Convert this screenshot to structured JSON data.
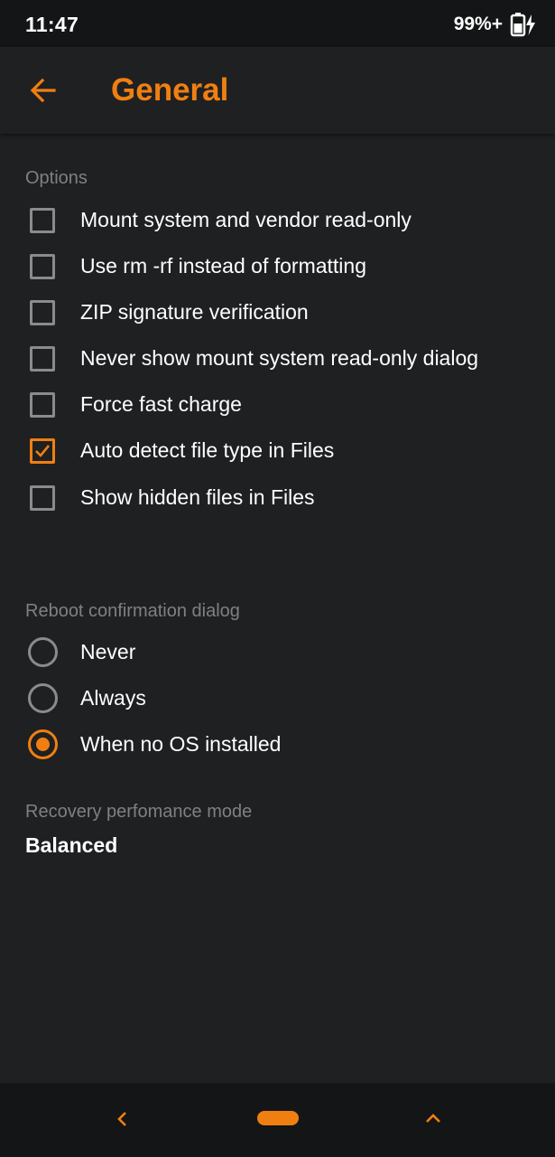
{
  "status": {
    "time": "11:47",
    "battery": "99%+"
  },
  "header": {
    "title": "General"
  },
  "options": {
    "header": "Options",
    "items": [
      {
        "label": "Mount system and vendor read-only",
        "checked": false
      },
      {
        "label": "Use rm -rf instead of formatting",
        "checked": false
      },
      {
        "label": "ZIP signature verification",
        "checked": false
      },
      {
        "label": "Never show mount system read-only dialog",
        "checked": false
      },
      {
        "label": "Force fast charge",
        "checked": false
      },
      {
        "label": "Auto detect file type in Files",
        "checked": true
      },
      {
        "label": "Show hidden files in Files",
        "checked": false
      }
    ]
  },
  "reboot": {
    "header": "Reboot confirmation dialog",
    "choices": [
      {
        "label": "Never",
        "selected": false
      },
      {
        "label": "Always",
        "selected": false
      },
      {
        "label": "When no OS installed",
        "selected": true
      }
    ]
  },
  "performance": {
    "header": "Recovery perfomance mode",
    "value": "Balanced"
  },
  "navigation": {
    "back_icon": "chevron-left-icon",
    "home_icon": "pill-home-icon",
    "recents_icon": "chevron-up-icon"
  },
  "colors": {
    "accent": "#f07f12",
    "background": "#1f2022",
    "bars": "#141516",
    "muted_text": "#7f8083"
  }
}
